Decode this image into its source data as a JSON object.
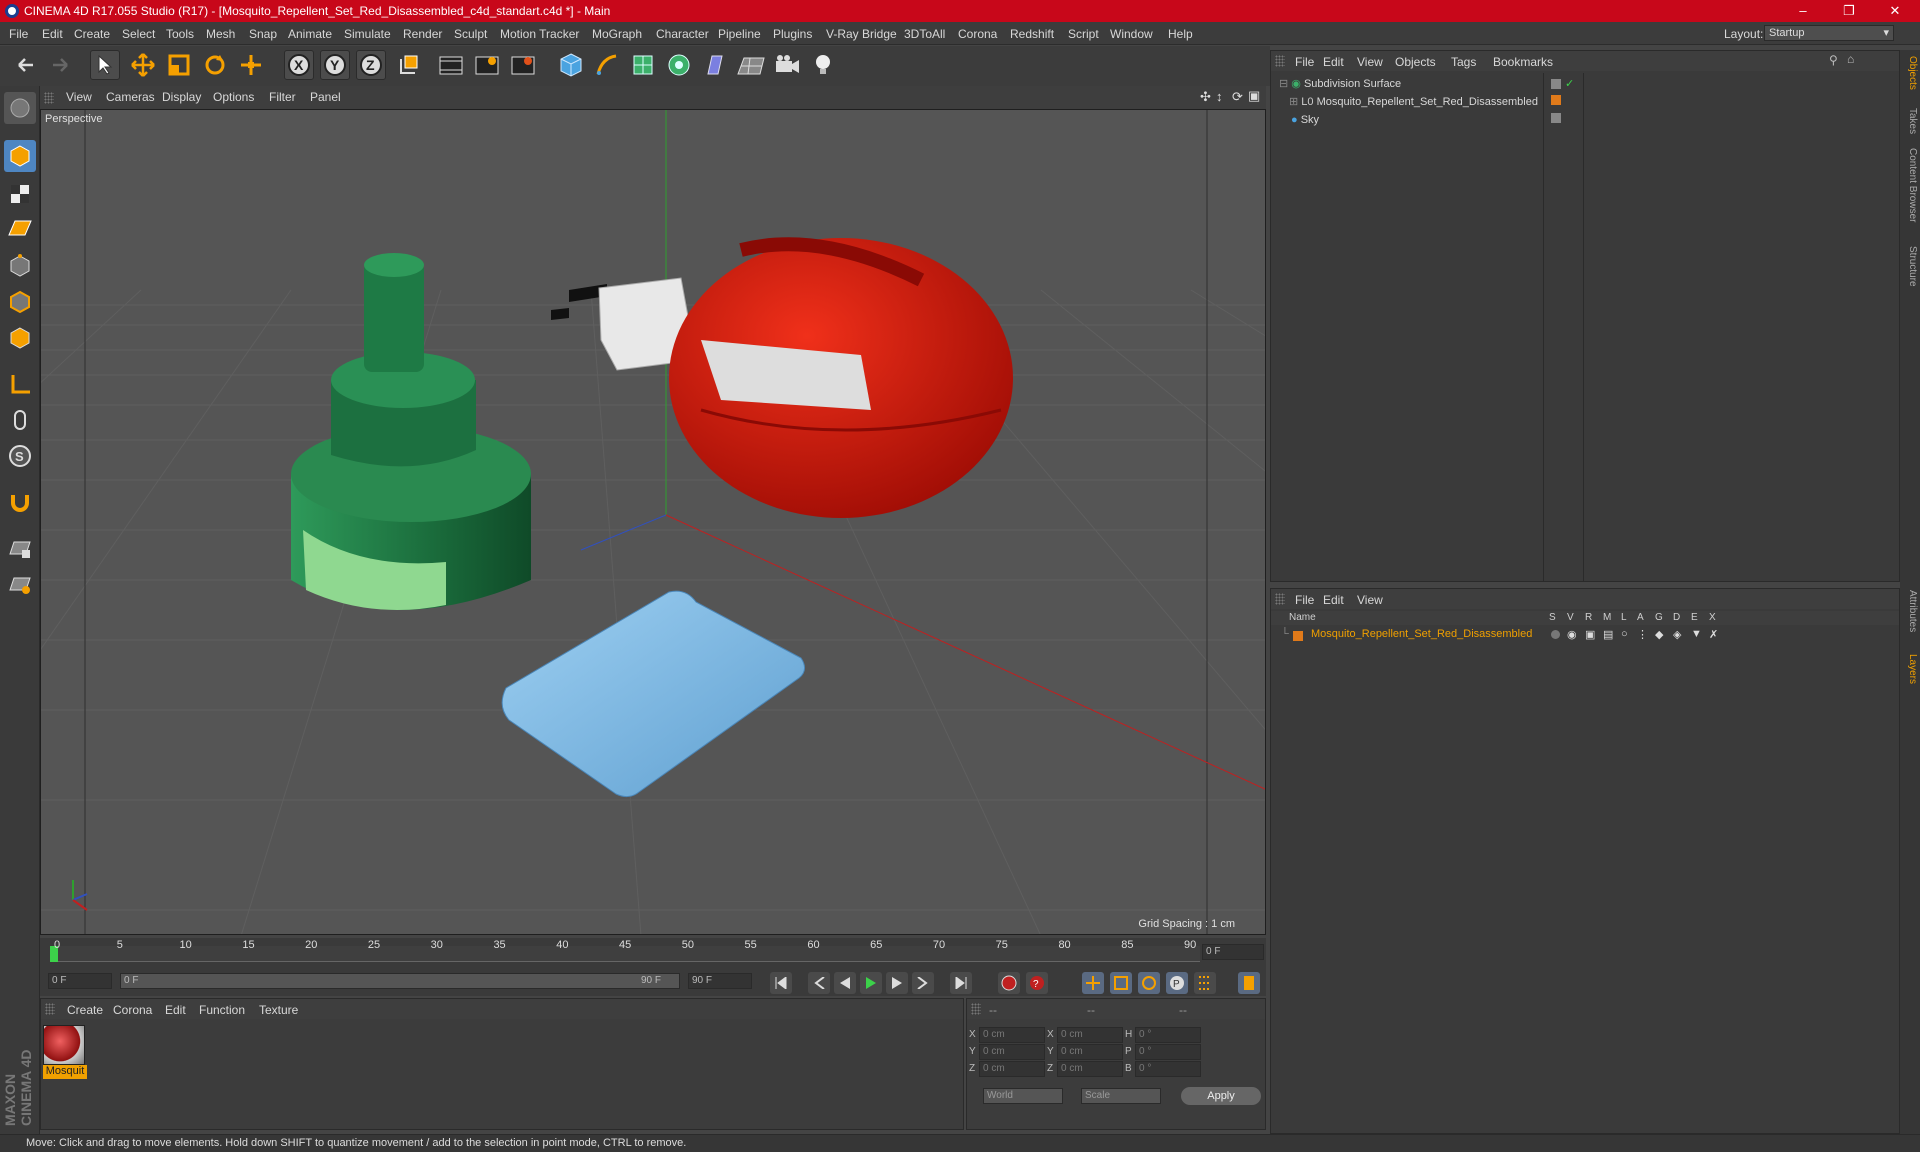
{
  "window": {
    "title": "CINEMA 4D R17.055 Studio (R17) - [Mosquito_Repellent_Set_Red_Disassembled_c4d_standart.c4d *] - Main",
    "controls": [
      "minimize",
      "restore",
      "close"
    ]
  },
  "menu": [
    "File",
    "Edit",
    "Create",
    "Select",
    "Tools",
    "Mesh",
    "Snap",
    "Animate",
    "Simulate",
    "Render",
    "Sculpt",
    "Motion Tracker",
    "MoGraph",
    "Character",
    "Pipeline",
    "Plugins",
    "V-Ray Bridge",
    "3DToAll",
    "Corona",
    "Redshift",
    "Script",
    "Window",
    "Help"
  ],
  "layout": {
    "label": "Layout:",
    "value": "Startup"
  },
  "toolbar": [
    "undo-icon",
    "redo-icon",
    "select-arrow-icon",
    "move-icon",
    "scale-icon",
    "rotate-icon",
    "move-plus-icon",
    "x-axis-icon",
    "y-axis-icon",
    "z-axis-icon",
    "coord-system-icon",
    "render-view-icon",
    "render-picture-viewer-icon",
    "render-settings-icon",
    "cube-icon",
    "pen-icon",
    "subdivision-icon",
    "array-icon",
    "deformer-icon",
    "floor-icon",
    "camera-icon",
    "light-icon"
  ],
  "viewport": {
    "menu": [
      "View",
      "Cameras",
      "Display",
      "Options",
      "Filter",
      "Panel"
    ],
    "label": "Perspective",
    "grid_spacing": "Grid Spacing : 1 cm"
  },
  "timeline": {
    "ticks": [
      "0",
      "5",
      "10",
      "15",
      "20",
      "25",
      "30",
      "35",
      "40",
      "45",
      "50",
      "55",
      "60",
      "65",
      "70",
      "75",
      "80",
      "85",
      "90"
    ],
    "current": "0 F",
    "start": "0 F",
    "range_start": "0 F",
    "range_end": "90 F",
    "end": "90 F"
  },
  "materials": {
    "menu": [
      "Create",
      "Corona",
      "Edit",
      "Function",
      "Texture"
    ],
    "items": [
      {
        "name": "Mosquit"
      }
    ]
  },
  "coords": {
    "header": [
      "--",
      "--",
      "--"
    ],
    "rows": [
      {
        "a": "X",
        "av": "0 cm",
        "b": "X",
        "bv": "0 cm",
        "c": "H",
        "cv": "0 °"
      },
      {
        "a": "Y",
        "av": "0 cm",
        "b": "Y",
        "bv": "0 cm",
        "c": "P",
        "cv": "0 °"
      },
      {
        "a": "Z",
        "av": "0 cm",
        "b": "Z",
        "bv": "0 cm",
        "c": "B",
        "cv": "0 °"
      }
    ],
    "mode1": "World",
    "mode2": "Scale",
    "apply": "Apply"
  },
  "objects": {
    "menu": [
      "File",
      "Edit",
      "View",
      "Objects",
      "Tags",
      "Bookmarks"
    ],
    "items": [
      {
        "name": "Subdivision Surface",
        "indent": 0
      },
      {
        "name": "Mosquito_Repellent_Set_Red_Disassembled",
        "indent": 1
      },
      {
        "name": "Sky",
        "indent": 0
      }
    ]
  },
  "layers": {
    "menu": [
      "File",
      "Edit",
      "View"
    ],
    "columns": [
      "Name",
      "S",
      "V",
      "R",
      "M",
      "L",
      "A",
      "G",
      "D",
      "E",
      "X"
    ],
    "items": [
      {
        "name": "Mosquito_Repellent_Set_Red_Disassembled",
        "color": "#e07a1a"
      }
    ]
  },
  "right_tabs": [
    "Objects",
    "Takes",
    "Content Browser",
    "Structure",
    "Attributes",
    "Layers"
  ],
  "status": "Move: Click and drag to move elements. Hold down SHIFT to quantize movement / add to the selection in point mode, CTRL to remove.",
  "colors": {
    "accent": "#c8071a",
    "highlight": "#f0a000"
  }
}
